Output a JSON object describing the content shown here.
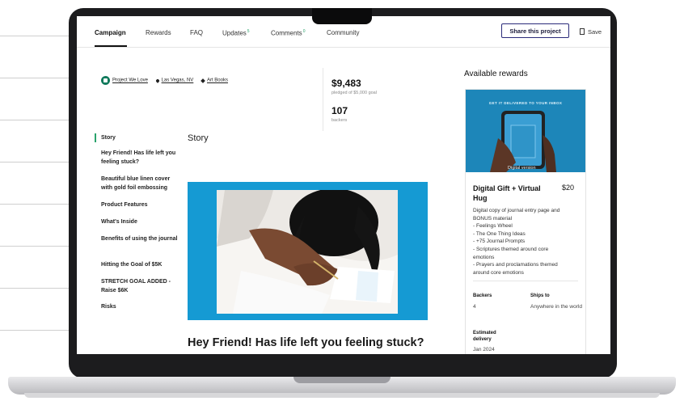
{
  "nav": {
    "tabs": [
      {
        "label": "Campaign",
        "badge": ""
      },
      {
        "label": "Rewards",
        "badge": ""
      },
      {
        "label": "FAQ",
        "badge": ""
      },
      {
        "label": "Updates",
        "badge": "5"
      },
      {
        "label": "Comments",
        "badge": "0"
      },
      {
        "label": "Community",
        "badge": ""
      }
    ],
    "share_label": "Share this project",
    "save_label": "Save"
  },
  "meta": {
    "creator": "Project We Love",
    "location": "Las Vegas, NV",
    "category": "Art Books"
  },
  "stats": {
    "amount": "$9,483",
    "pledged_label": "pledged of $5,000 goal",
    "backers": "107",
    "backers_label": "backers"
  },
  "toc": [
    "Story",
    "Hey Friend! Has life left you feeling stuck?",
    "Beautiful blue linen cover with gold foil embossing",
    "Product Features",
    "What's Inside",
    "Benefits of using the journal",
    "Hitting the Goal of $5K",
    "STRETCH GOAL ADDED - Raise $6K",
    "Risks"
  ],
  "story": {
    "heading": "Story",
    "section_title": "Hey Friend! Has life left you feeling stuck?"
  },
  "rewards": {
    "heading": "Available rewards",
    "card": {
      "banner": "GET IT DELIVERED TO YOUR INBOX",
      "caption": "Digital version",
      "title": "Digital Gift + Virtual Hug",
      "price": "$20",
      "description": [
        "Digital copy of journal entry page and",
        "BONUS material",
        "- Feelings Wheel",
        "- The One Thing Ideas",
        "- +75 Journal Prompts",
        "- Scriptures themed around core",
        "emotions",
        "- Prayers and proclamations themed",
        "around core emotions"
      ],
      "backers_label": "Backers",
      "backers_value": "4",
      "ships_label": "Ships to",
      "ships_value": "Anywhere in the world",
      "delivery_label": "Estimated delivery",
      "delivery_value": "Jan 2024"
    }
  },
  "colors": {
    "accent": "#2aa36c",
    "hero_blue": "#159ad3",
    "card_blue": "#1d86b9",
    "button_border": "#2b2b7a"
  }
}
